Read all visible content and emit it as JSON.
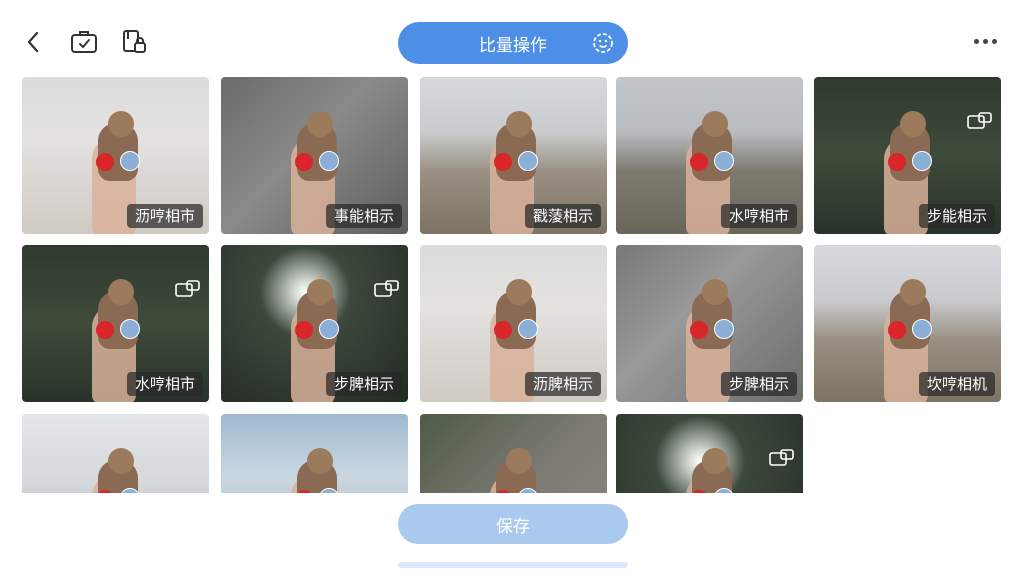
{
  "toolbar": {
    "back_icon": "chevron-left-icon",
    "edit_icon": "briefcase-check-icon",
    "lock_icon": "document-lock-icon",
    "batch_label": "比量操作",
    "batch_icon": "face-scan-icon",
    "more_icon": "more-dots-icon"
  },
  "tiles": [
    {
      "label": "沥哼相市",
      "theme": "beach",
      "ops": false
    },
    {
      "label": "事能相示",
      "theme": "floor",
      "ops": false
    },
    {
      "label": "戳蔆相示",
      "theme": "pier",
      "ops": false
    },
    {
      "label": "水哼相市",
      "theme": "field",
      "ops": false
    },
    {
      "label": "步能相示",
      "theme": "forest",
      "ops": true
    },
    {
      "label": "水哼相市",
      "theme": "forest",
      "ops": true
    },
    {
      "label": "步脾相示",
      "theme": "forest-sun",
      "ops": true
    },
    {
      "label": "沥脾相示",
      "theme": "beach",
      "ops": false
    },
    {
      "label": "步脾相示",
      "theme": "frame",
      "ops": false
    },
    {
      "label": "坎哼相机",
      "theme": "pier",
      "ops": false
    },
    {
      "label": "",
      "theme": "pier-sky",
      "ops": false
    },
    {
      "label": "",
      "theme": "sea",
      "ops": false
    },
    {
      "label": "",
      "theme": "floor-plant",
      "ops": false
    },
    {
      "label": "",
      "theme": "forest-sun",
      "ops": true
    }
  ],
  "save_label": "保存",
  "colors": {
    "accent": "#4d8fe6",
    "save_disabled": "#a9c9ee",
    "tag_bg": "#333333"
  }
}
